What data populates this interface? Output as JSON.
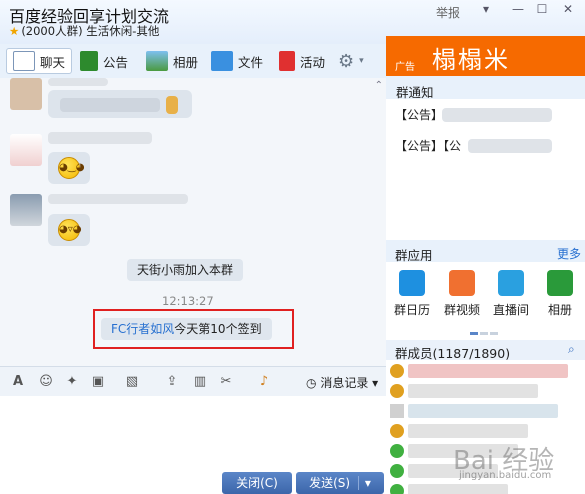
{
  "window": {
    "title": "百度经验回享计划交流",
    "subtitle": "(2000人群) 生活休闲-其他",
    "report": "举报",
    "controls": [
      "▾",
      "—",
      "☐",
      "✕"
    ]
  },
  "toolbar": {
    "items": [
      {
        "label": "聊天",
        "icon": "chat-icon"
      },
      {
        "label": "公告",
        "icon": "announcement-flag-icon"
      },
      {
        "label": "相册",
        "icon": "photo-album-icon"
      },
      {
        "label": "文件",
        "icon": "folder-icon"
      },
      {
        "label": "活动",
        "icon": "activity-flag-icon"
      }
    ],
    "settings_icon": "gear-icon"
  },
  "chat": {
    "system_message_1": "天街小雨加入本群",
    "timestamp": "12:13:27",
    "signin_user": "FC行者如风",
    "signin_text": "今天第10个签到",
    "emoji_1": "◕‿◕",
    "emoji_2": "◕▿◕"
  },
  "editbar": {
    "icons": [
      "font-icon",
      "emoji-icon",
      "magic-icon",
      "screenshot-icon",
      "image-icon",
      "upload-icon",
      "gift-icon",
      "scissors-icon",
      "bell-icon"
    ],
    "history_label": "消息记录"
  },
  "buttons": {
    "close": "关闭(C)",
    "send": "发送(S)"
  },
  "sidebar": {
    "ad_tag": "广告",
    "ad_text": "榻榻米",
    "notice_header": "群通知",
    "notices": [
      "【公告】",
      "【公告】【公"
    ],
    "apps_header": "群应用",
    "more": "更多",
    "apps": [
      {
        "label": "群日历",
        "icon": "calendar-icon",
        "color": "#1e90e0"
      },
      {
        "label": "群视频",
        "icon": "video-icon",
        "color": "#f07030"
      },
      {
        "label": "直播间",
        "icon": "live-icon",
        "color": "#2aa0e0"
      },
      {
        "label": "相册",
        "icon": "album-icon",
        "color": "#2a9a3a"
      }
    ],
    "members_header": "群成员(1187/1890)"
  },
  "watermark": {
    "text": "Bai 经验",
    "url": "jingyan.baidu.com"
  }
}
